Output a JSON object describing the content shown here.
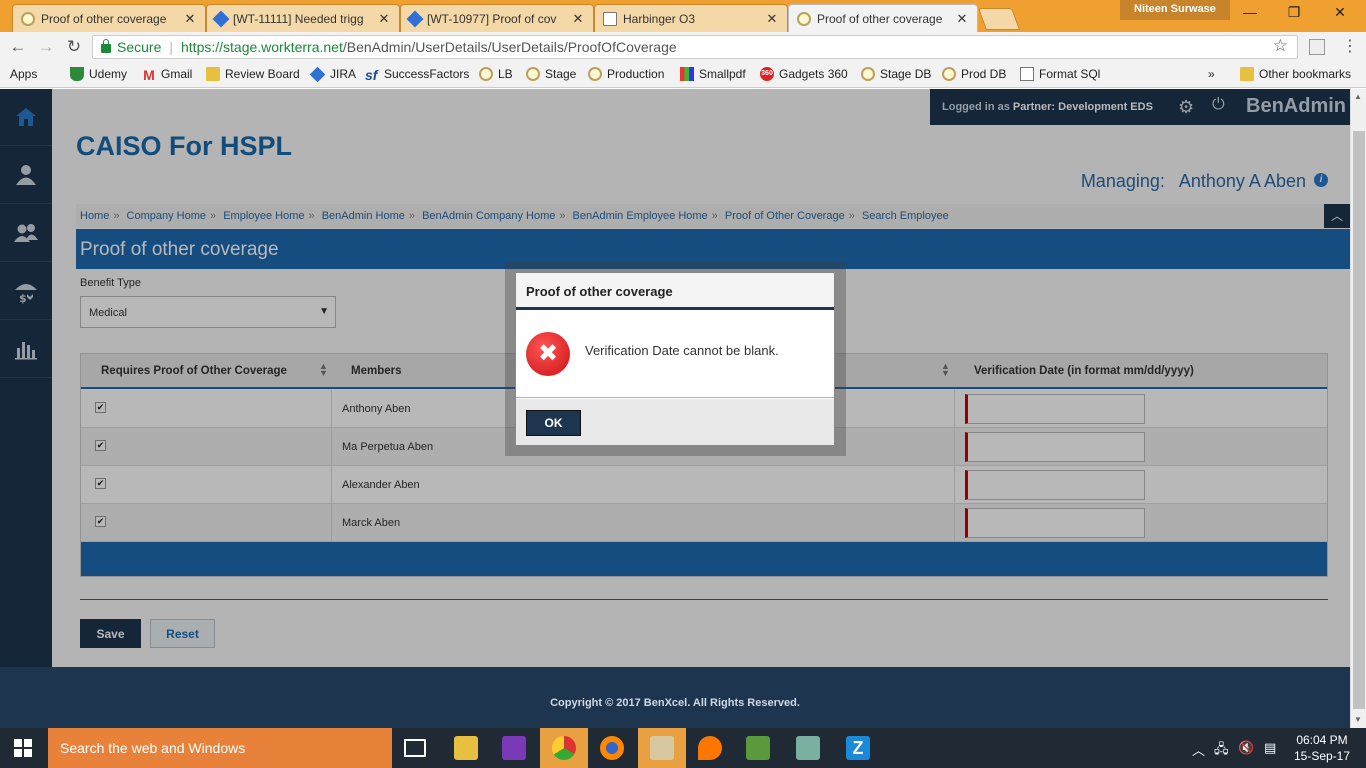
{
  "browser": {
    "tabs": [
      {
        "title": "Proof of other coverage",
        "icon": "generic-site-icon"
      },
      {
        "title": "[WT-11111] Needed trigg",
        "icon": "jira-icon"
      },
      {
        "title": "[WT-10977] Proof of cov",
        "icon": "jira-icon"
      },
      {
        "title": "Harbinger O3",
        "icon": "document-icon"
      },
      {
        "title": "Proof of other coverage",
        "icon": "generic-site-icon"
      }
    ],
    "profile_name": "Niteen Surwase",
    "secure_label": "Secure",
    "url_host": "https://stage.workterra.net",
    "url_path": "/BenAdmin/UserDetails/UserDetails/ProofOfCoverage",
    "bookmarks": [
      "Apps",
      "Udemy",
      "Gmail",
      "Review Board",
      "JIRA",
      "SuccessFactors",
      "LB",
      "Stage",
      "Production",
      "Smallpdf",
      "Gadgets 360",
      "Stage DB",
      "Prod DB",
      "Format SQl"
    ],
    "bookmarks_overflow": "»",
    "other_bookmarks": "Other bookmarks"
  },
  "header": {
    "logged_in_prefix": "Logged in as",
    "partner_label": "Partner:",
    "partner_name": "Development EDS",
    "brand": "BenAdmin",
    "company": "CAISO For HSPL",
    "managing_label": "Managing:",
    "managing_name": "Anthony A Aben"
  },
  "breadcrumb": [
    "Home",
    "Company Home",
    "Employee Home",
    "BenAdmin Home",
    "BenAdmin Company Home",
    "BenAdmin Employee Home",
    "Proof of Other Coverage",
    "Search Employee"
  ],
  "section_title": "Proof of other coverage",
  "benefit": {
    "label": "Benefit Type",
    "selected": "Medical"
  },
  "grid": {
    "columns": [
      "Requires Proof of Other Coverage",
      "Members",
      "Verification Date (in format mm/dd/yyyy)"
    ],
    "rows": [
      {
        "checked": true,
        "member": "Anthony Aben",
        "date": ""
      },
      {
        "checked": true,
        "member": "Ma Perpetua Aben",
        "date": ""
      },
      {
        "checked": true,
        "member": "Alexander Aben",
        "date": ""
      },
      {
        "checked": true,
        "member": "Marck Aben",
        "date": ""
      }
    ]
  },
  "buttons": {
    "save": "Save",
    "reset": "Reset"
  },
  "footer": "Copyright © 2017 BenXcel. All Rights Reserved.",
  "modal": {
    "title": "Proof of other coverage",
    "message": "Verification Date cannot be blank.",
    "ok": "OK"
  },
  "taskbar": {
    "search_placeholder": "Search the web and Windows",
    "time": "06:04 PM",
    "date": "15-Sep-17"
  }
}
